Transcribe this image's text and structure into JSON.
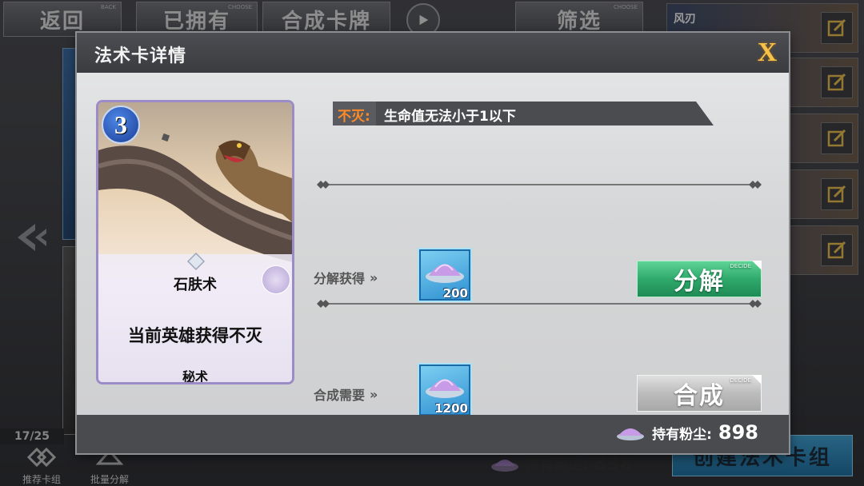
{
  "background": {
    "top_buttons": {
      "back": "返回",
      "back_tag": "BACK",
      "owned": "已拥有",
      "owned_tag": "CHOOSE",
      "craft": "合成卡牌",
      "filter": "筛选",
      "filter_tag": "CHOOSE"
    },
    "right_deck": {
      "first_title": "风刃"
    },
    "deck_count": "17/25",
    "bottom": {
      "recommend": "推荐卡组",
      "batch": "批量分解",
      "dust_label": "持有粉尘:",
      "dust_value": "898",
      "create": "创建法术卡组"
    }
  },
  "dialog": {
    "title": "法术卡详情",
    "close_label": "X",
    "card": {
      "cost": "3",
      "name": "石肤术",
      "description": "当前英雄获得不灭",
      "type": "秘术"
    },
    "effect": {
      "keyword": "不灭:",
      "text": "生命值无法小于1以下"
    },
    "disenchant": {
      "label": "分解获得",
      "chevrons": "»",
      "amount": "200",
      "button": "分解",
      "button_tag": "DECIDE"
    },
    "craft": {
      "label": "合成需要",
      "chevrons": "»",
      "amount": "1200",
      "button": "合成",
      "button_tag": "DECIDE"
    },
    "footer": {
      "dust_label": "持有粉尘:",
      "dust_value": "898"
    }
  },
  "colors": {
    "keyword": "#ff8a26",
    "disenchant_button": "#2faa6c",
    "craft_button": "#bcbcbc",
    "close": "#f6c24a"
  }
}
